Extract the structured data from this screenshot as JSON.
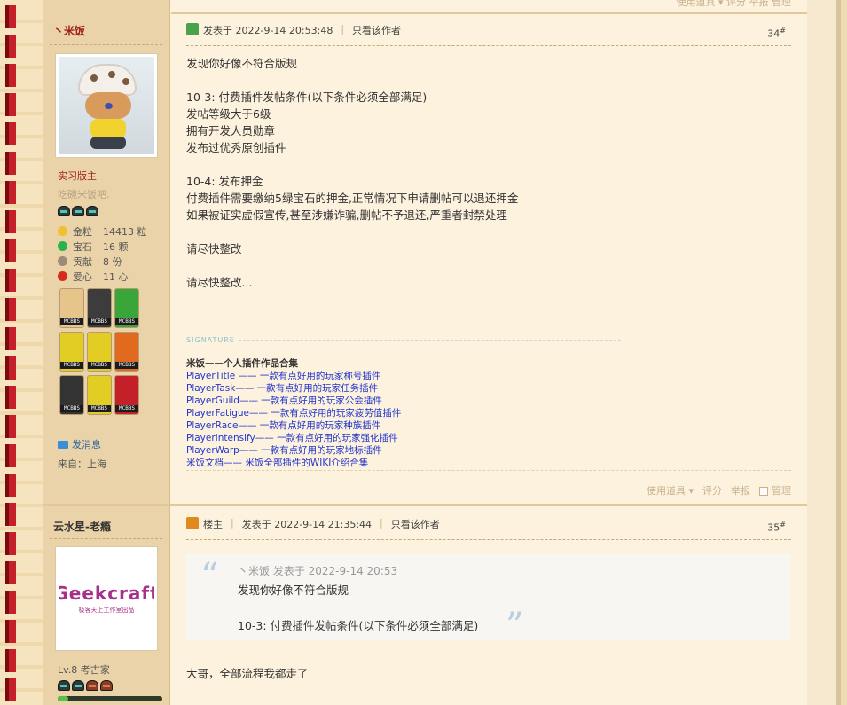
{
  "colors": {
    "accent_red": "#c4202a",
    "link_blue": "#2234cc",
    "bg": "#fdf2dd",
    "sidebar": "#ead3a8"
  },
  "post1": {
    "author": "丶米饭",
    "rank_title": "实习版主",
    "custom_title": "吃碗米饭吧.",
    "stats": [
      {
        "icon": "gold-coin-icon",
        "label": "金粒",
        "value": "14413 粒",
        "color": "#f0c030"
      },
      {
        "icon": "gem-icon",
        "label": "宝石",
        "value": "16 颗",
        "color": "#2bb24c"
      },
      {
        "icon": "contribution-icon",
        "label": "贡献",
        "value": "8 份",
        "color": "#9e8a76"
      },
      {
        "icon": "heart-icon",
        "label": "爱心",
        "value": "11 心",
        "color": "#d62a1e"
      }
    ],
    "medals": [
      {
        "icon": "checklist-medal-icon",
        "bg": "#e7c48a"
      },
      {
        "icon": "redstone-medal-icon",
        "bg": "#3c3c3c"
      },
      {
        "icon": "creeper-medal-icon",
        "bg": "#3aa63a"
      },
      {
        "icon": "golden-pickaxe-medal-icon",
        "bg": "#e1cd24"
      },
      {
        "icon": "golden-pickaxe-medal-icon",
        "bg": "#e1cd24"
      },
      {
        "icon": "vine-medal-icon",
        "bg": "#e06a1e"
      },
      {
        "icon": "ore-medal-icon",
        "bg": "#333333"
      },
      {
        "icon": "diamond-pickaxe-medal-icon",
        "bg": "#e1cd24"
      },
      {
        "icon": "java-medal-icon",
        "bg": "#c4202a"
      }
    ],
    "medal_tag": "MCBBS",
    "send_message": "发消息",
    "from": "来自：上海",
    "posted_at": "发表于 2022-9-14 20:53:48",
    "only_author": "只看该作者",
    "floor": "34",
    "body": [
      "发现你好像不符合版规",
      "",
      "10-3: 付费插件发帖条件(以下条件必须全部满足)",
      "发帖等级大于6级",
      "拥有开发人员勋章",
      "发布过优秀原创插件",
      "",
      "10-4: 发布押金",
      "付费插件需要缴纳5绿宝石的押金,正常情况下申请删帖可以退还押金",
      "如果被证实虚假宣传,甚至涉嫌诈骗,删帖不予退还,严重者封禁处理",
      "",
      "请尽快整改",
      "",
      "请尽快整改..."
    ],
    "signature_label": "SIGNATURE",
    "signature_title": "米饭——个人插件作品合集",
    "signature_links": [
      "PlayerTitle —— 一款有点好用的玩家称号插件",
      "PlayerTask—— 一款有点好用的玩家任务插件",
      "PlayerGuild—— 一款有点好用的玩家公会插件",
      "PlayerFatigue—— 一款有点好用的玩家疲劳值插件",
      "PlayerRace—— 一款有点好用的玩家种族插件",
      "PlayerIntensify—— 一款有点好用的玩家强化插件",
      "PlayerWarp—— 一款有点好用的玩家地标插件",
      "米饭文档—— 米饭全部插件的WIKI介绍合集"
    ],
    "actions": {
      "tools": "使用道具",
      "rate": "评分",
      "report": "举报",
      "manage": "管理"
    }
  },
  "post2": {
    "author": "云水星-老瘾",
    "logo_text": "Geekcraft",
    "logo_sub": "极客天上工作室出品",
    "level": "Lv.8 考古家",
    "level_progress": 0.1,
    "op_label": "楼主",
    "posted_at": "发表于 2022-9-14 21:35:44",
    "only_author": "只看该作者",
    "floor": "35",
    "quote_head": "丶米饭 发表于 2022-9-14 20:53",
    "quote_lines": [
      "发现你好像不符合版规",
      "",
      "10-3: 付费插件发帖条件(以下条件必须全部满足)"
    ],
    "reply": "大哥，全部流程我都走了"
  },
  "top_actions": "使用道具 ▾   评分   举报   管理"
}
